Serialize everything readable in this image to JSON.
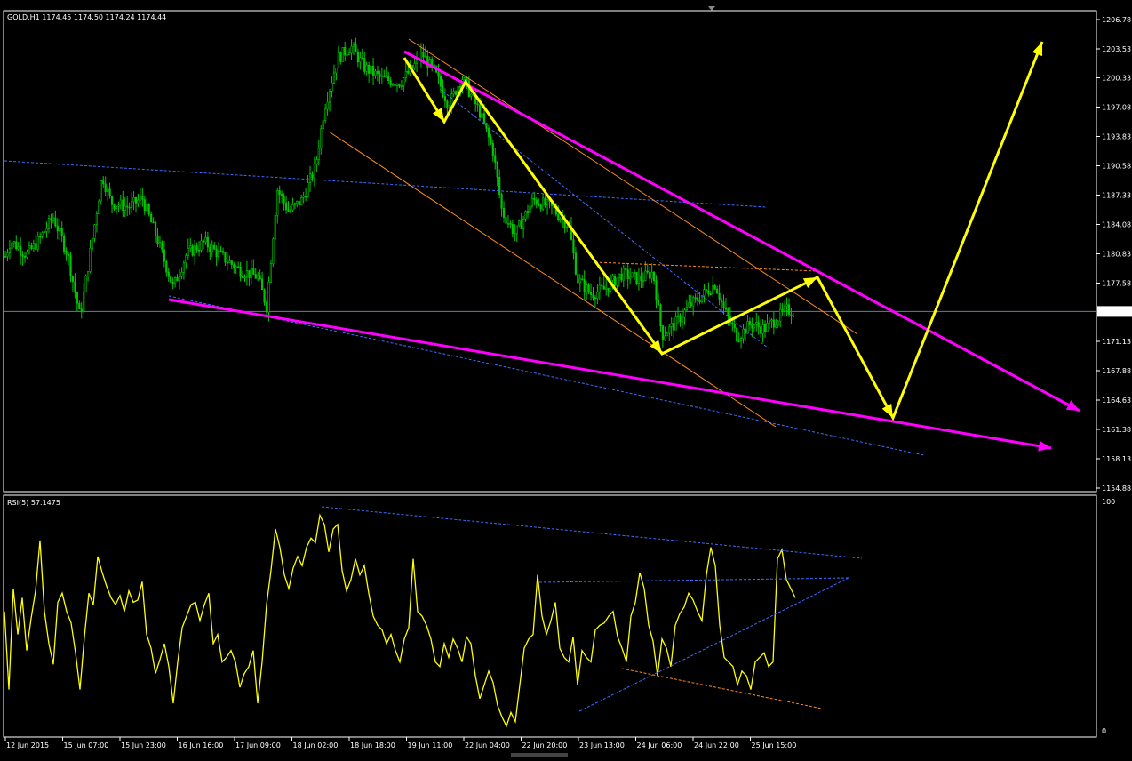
{
  "header": {
    "symbol_info": "GOLD,H1  1174.45 1174.50 1174.24 1174.44",
    "rsi_label": "RSI(5) 57.1475"
  },
  "colors": {
    "background": "#000000",
    "frame": "#ffffff",
    "bull_candle": "#00c800",
    "bear_candle": "#00c800",
    "rsi_line": "#ffff00",
    "arrow_yellow": "#ffff00",
    "trend_magenta": "#ff00ff",
    "channel_orange": "#ff8c1a",
    "trend_blue": "#3d6cff",
    "last_price_line": "#6a7da0"
  },
  "price_axis": {
    "labels": [
      "1206.78",
      "1203.53",
      "1200.33",
      "1197.08",
      "1193.83",
      "1190.58",
      "1187.33",
      "1184.08",
      "1180.83",
      "1177.58",
      "1174.44",
      "1171.13",
      "1167.88",
      "1164.63",
      "1161.38",
      "1158.13",
      "1154.88"
    ],
    "last_price": "1174.44",
    "ylim": [
      1154.88,
      1206.78
    ]
  },
  "rsi_axis": {
    "labels": [
      "100",
      "0"
    ],
    "ylim": [
      0,
      100
    ]
  },
  "time_axis": {
    "labels": [
      "12 Jun 2015",
      "15 Jun 07:00",
      "15 Jun 23:00",
      "16 Jun 16:00",
      "17 Jun 09:00",
      "18 Jun 02:00",
      "18 Jun 18:00",
      "19 Jun 11:00",
      "22 Jun 04:00",
      "22 Jun 20:00",
      "23 Jun 13:00",
      "24 Jun 06:00",
      "24 Jun 22:00",
      "25 Jun 15:00"
    ]
  },
  "chart_data": [
    {
      "type": "line",
      "name": "price",
      "x_start": "12 Jun 2015",
      "timeframe": "H1",
      "ylim": [
        1154.88,
        1206.78
      ],
      "anchors": [
        [
          0,
          1178.8
        ],
        [
          12,
          1182.3
        ],
        [
          30,
          1180.7
        ],
        [
          42,
          1182.1
        ],
        [
          60,
          1184.9
        ],
        [
          76,
          1180.8
        ],
        [
          90,
          1173.8
        ],
        [
          100,
          1180.0
        ],
        [
          115,
          1189.5
        ],
        [
          125,
          1186.5
        ],
        [
          145,
          1186.0
        ],
        [
          160,
          1187.0
        ],
        [
          175,
          1183.0
        ],
        [
          195,
          1177.1
        ],
        [
          210,
          1180.8
        ],
        [
          230,
          1182.1
        ],
        [
          250,
          1180.5
        ],
        [
          270,
          1179.0
        ],
        [
          290,
          1178.3
        ],
        [
          300,
          1175.0
        ],
        [
          312,
          1188.0
        ],
        [
          325,
          1185.5
        ],
        [
          340,
          1186.8
        ],
        [
          355,
          1190.5
        ],
        [
          365,
          1197.0
        ],
        [
          380,
          1202.5
        ],
        [
          395,
          1203.8
        ],
        [
          410,
          1201.5
        ],
        [
          430,
          1200.2
        ],
        [
          450,
          1199.8
        ],
        [
          465,
          1201.5
        ],
        [
          475,
          1203.0
        ],
        [
          490,
          1200.8
        ],
        [
          505,
          1197.3
        ],
        [
          520,
          1200.4
        ],
        [
          540,
          1196.5
        ],
        [
          555,
          1192.2
        ],
        [
          565,
          1185.5
        ],
        [
          580,
          1183.0
        ],
        [
          600,
          1186.8
        ],
        [
          620,
          1186.0
        ],
        [
          640,
          1184.0
        ],
        [
          650,
          1178.0
        ],
        [
          665,
          1176.4
        ],
        [
          680,
          1176.9
        ],
        [
          700,
          1178.6
        ],
        [
          720,
          1178.0
        ],
        [
          735,
          1178.8
        ],
        [
          745,
          1171.8
        ],
        [
          760,
          1173.1
        ],
        [
          775,
          1175.0
        ],
        [
          790,
          1176.2
        ],
        [
          805,
          1177.5
        ],
        [
          815,
          1174.6
        ],
        [
          830,
          1171.6
        ],
        [
          845,
          1173.1
        ],
        [
          860,
          1172.5
        ],
        [
          875,
          1173.7
        ],
        [
          885,
          1174.6
        ],
        [
          895,
          1174.4
        ]
      ]
    },
    {
      "type": "line",
      "name": "RSI(5)",
      "ylim": [
        0,
        100
      ],
      "last_value": 57.1475,
      "values": [
        [
          5,
          52
        ],
        [
          10,
          18
        ],
        [
          15,
          62
        ],
        [
          20,
          42
        ],
        [
          25,
          58
        ],
        [
          30,
          35
        ],
        [
          35,
          49
        ],
        [
          40,
          61
        ],
        [
          45,
          83
        ],
        [
          50,
          52
        ],
        [
          55,
          38
        ],
        [
          60,
          29
        ],
        [
          65,
          56
        ],
        [
          70,
          60
        ],
        [
          75,
          52
        ],
        [
          80,
          47
        ],
        [
          85,
          34
        ],
        [
          90,
          18
        ],
        [
          95,
          41
        ],
        [
          100,
          60
        ],
        [
          105,
          55
        ],
        [
          110,
          76
        ],
        [
          115,
          69
        ],
        [
          120,
          63
        ],
        [
          125,
          58
        ],
        [
          130,
          55
        ],
        [
          135,
          59
        ],
        [
          140,
          52
        ],
        [
          145,
          61
        ],
        [
          150,
          56
        ],
        [
          155,
          57
        ],
        [
          160,
          65
        ],
        [
          165,
          42
        ],
        [
          170,
          36
        ],
        [
          175,
          25
        ],
        [
          180,
          31
        ],
        [
          185,
          38
        ],
        [
          190,
          28
        ],
        [
          195,
          12
        ],
        [
          200,
          30
        ],
        [
          205,
          45
        ],
        [
          210,
          50
        ],
        [
          215,
          55
        ],
        [
          220,
          56
        ],
        [
          225,
          48
        ],
        [
          230,
          55
        ],
        [
          235,
          60
        ],
        [
          240,
          38
        ],
        [
          245,
          42
        ],
        [
          250,
          30
        ],
        [
          255,
          32
        ],
        [
          260,
          35
        ],
        [
          265,
          30
        ],
        [
          270,
          19
        ],
        [
          275,
          25
        ],
        [
          280,
          28
        ],
        [
          285,
          35
        ],
        [
          290,
          12
        ],
        [
          295,
          30
        ],
        [
          300,
          55
        ],
        [
          305,
          70
        ],
        [
          310,
          88
        ],
        [
          315,
          80
        ],
        [
          320,
          68
        ],
        [
          325,
          62
        ],
        [
          330,
          71
        ],
        [
          335,
          76
        ],
        [
          340,
          72
        ],
        [
          345,
          80
        ],
        [
          350,
          84
        ],
        [
          355,
          82
        ],
        [
          360,
          94
        ],
        [
          365,
          90
        ],
        [
          370,
          78
        ],
        [
          375,
          88
        ],
        [
          380,
          90
        ],
        [
          385,
          70
        ],
        [
          390,
          61
        ],
        [
          395,
          66
        ],
        [
          400,
          75
        ],
        [
          405,
          68
        ],
        [
          410,
          72
        ],
        [
          415,
          60
        ],
        [
          420,
          50
        ],
        [
          425,
          46
        ],
        [
          430,
          44
        ],
        [
          435,
          38
        ],
        [
          440,
          42
        ],
        [
          445,
          35
        ],
        [
          450,
          30
        ],
        [
          455,
          40
        ],
        [
          460,
          45
        ],
        [
          465,
          75
        ],
        [
          470,
          52
        ],
        [
          475,
          50
        ],
        [
          480,
          46
        ],
        [
          485,
          40
        ],
        [
          490,
          30
        ],
        [
          495,
          28
        ],
        [
          500,
          38
        ],
        [
          505,
          32
        ],
        [
          510,
          40
        ],
        [
          515,
          36
        ],
        [
          520,
          30
        ],
        [
          525,
          41
        ],
        [
          530,
          38
        ],
        [
          535,
          24
        ],
        [
          540,
          14
        ],
        [
          545,
          20
        ],
        [
          550,
          26
        ],
        [
          555,
          21
        ],
        [
          560,
          11
        ],
        [
          565,
          6
        ],
        [
          570,
          2
        ],
        [
          575,
          8
        ],
        [
          580,
          4
        ],
        [
          585,
          20
        ],
        [
          590,
          36
        ],
        [
          595,
          40
        ],
        [
          600,
          42
        ],
        [
          605,
          68
        ],
        [
          610,
          50
        ],
        [
          615,
          42
        ],
        [
          620,
          48
        ],
        [
          625,
          56
        ],
        [
          630,
          36
        ],
        [
          635,
          32
        ],
        [
          640,
          30
        ],
        [
          645,
          41
        ],
        [
          650,
          20
        ],
        [
          655,
          35
        ],
        [
          660,
          32
        ],
        [
          665,
          30
        ],
        [
          670,
          44
        ],
        [
          675,
          46
        ],
        [
          680,
          47
        ],
        [
          685,
          50
        ],
        [
          690,
          52
        ],
        [
          695,
          41
        ],
        [
          700,
          36
        ],
        [
          705,
          30
        ],
        [
          710,
          50
        ],
        [
          715,
          56
        ],
        [
          720,
          69
        ],
        [
          725,
          62
        ],
        [
          730,
          46
        ],
        [
          735,
          39
        ],
        [
          740,
          24
        ],
        [
          745,
          40
        ],
        [
          750,
          36
        ],
        [
          755,
          28
        ],
        [
          760,
          46
        ],
        [
          765,
          51
        ],
        [
          770,
          54
        ],
        [
          775,
          60
        ],
        [
          780,
          57
        ],
        [
          785,
          52
        ],
        [
          790,
          48
        ],
        [
          795,
          68
        ],
        [
          800,
          80
        ],
        [
          805,
          72
        ],
        [
          810,
          46
        ],
        [
          815,
          32
        ],
        [
          820,
          30
        ],
        [
          825,
          28
        ],
        [
          830,
          20
        ],
        [
          835,
          26
        ],
        [
          840,
          24
        ],
        [
          845,
          18
        ],
        [
          850,
          30
        ],
        [
          855,
          32
        ],
        [
          860,
          34
        ],
        [
          865,
          28
        ],
        [
          870,
          30
        ],
        [
          875,
          75
        ],
        [
          880,
          79
        ],
        [
          885,
          66
        ],
        [
          890,
          62
        ],
        [
          895,
          58
        ]
      ]
    }
  ],
  "drawings": {
    "arrow_path": [
      [
        455,
        65
      ],
      [
        500,
        137
      ],
      [
        524,
        92
      ],
      [
        745,
        398
      ],
      [
        920,
        312
      ],
      [
        1005,
        470
      ],
      [
        1173,
        47
      ]
    ],
    "magenta_lines": [
      [
        [
          455,
          58
        ],
        [
          1215,
          462
        ]
      ],
      [
        [
          190,
          337
        ],
        [
          1183,
          504
        ]
      ]
    ],
    "orange_channel": [
      [
        [
          460,
          44
        ],
        [
          965,
          376
        ]
      ],
      [
        [
          370,
          148
        ],
        [
          873,
          480
        ]
      ]
    ],
    "orange_dotted": [
      [
        670,
        295
      ],
      [
        920,
        305
      ]
    ],
    "blue_dotted_price": [
      [
        [
          5,
          181
        ],
        [
          862,
          233
        ]
      ],
      [
        [
          495,
          100
        ],
        [
          865,
          392
        ]
      ],
      [
        [
          190,
          333
        ],
        [
          1040,
          512
        ]
      ]
    ],
    "rsi_blue_dotted": [
      [
        [
          362,
          570
        ],
        [
          970,
          628
        ]
      ],
      [
        [
          607,
          655
        ],
        [
          955,
          650
        ]
      ],
      [
        [
          652,
          800
        ],
        [
          955,
          650
        ]
      ]
    ],
    "rsi_blue_pair": [
      [
        [
          803,
          612
        ],
        [
          970,
          628
        ]
      ],
      [
        [
          820,
          642
        ],
        [
          955,
          650
        ]
      ]
    ],
    "rsi_orange_dotted": [
      [
        700,
        752
      ],
      [
        925,
        797
      ]
    ]
  }
}
